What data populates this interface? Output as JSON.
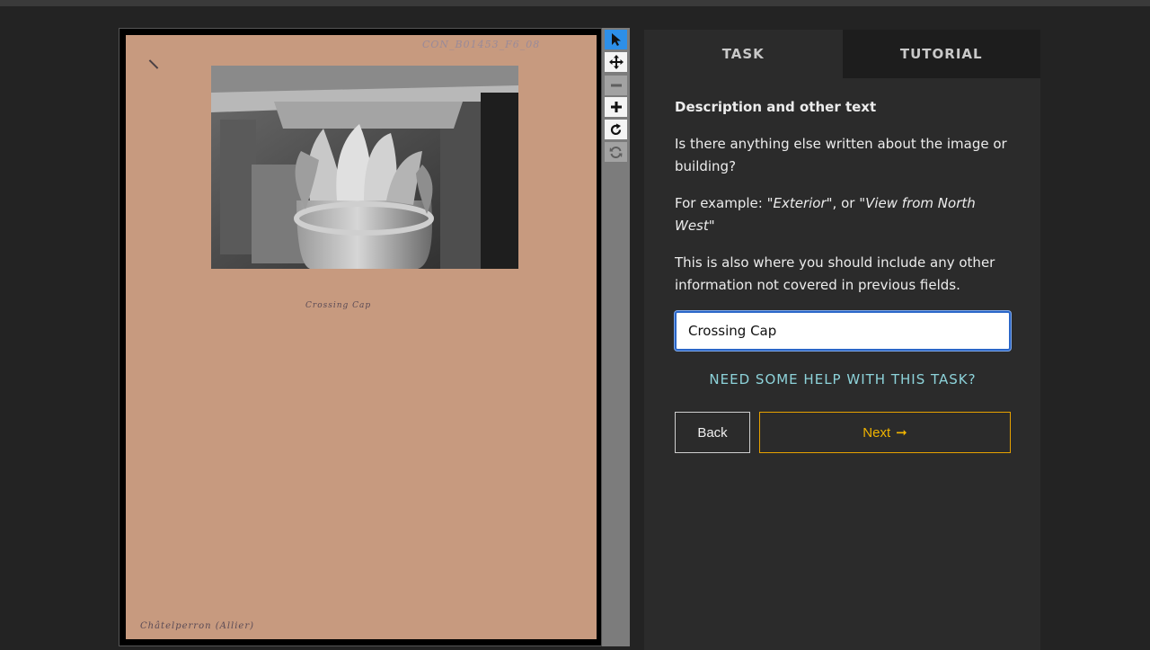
{
  "viewer": {
    "card": {
      "id_text": "CON_B01453_F6_08",
      "caption": "Crossing Cap",
      "location": "Châtelperron (Allier)"
    },
    "toolbar": {
      "tools": [
        {
          "name": "select",
          "icon": "pointer-icon",
          "state": "active"
        },
        {
          "name": "pan",
          "icon": "move-icon",
          "state": "enabled"
        },
        {
          "name": "zoom-out",
          "icon": "minus-icon",
          "state": "disabled"
        },
        {
          "name": "zoom-in",
          "icon": "plus-icon",
          "state": "enabled"
        },
        {
          "name": "rotate",
          "icon": "rotate-icon",
          "state": "enabled"
        },
        {
          "name": "reset",
          "icon": "reset-icon",
          "state": "disabled"
        }
      ]
    }
  },
  "panel": {
    "tabs": [
      {
        "label": "TASK",
        "active": true
      },
      {
        "label": "TUTORIAL",
        "active": false
      }
    ],
    "heading": "Description and other text",
    "question": "Is there anything else written about the image or building?",
    "example_prefix": "For example: ",
    "example_1": "\"Exterior\"",
    "example_sep": ", or ",
    "example_2": "\"View from North West\"",
    "info": "This is also where you should include any other information not covered in previous fields.",
    "input_value": "Crossing Cap",
    "help_link": "NEED SOME HELP WITH THIS TASK?",
    "back_label": "Back",
    "next_label": "Next",
    "next_arrow": "➞"
  },
  "colors": {
    "background": "#232323",
    "panel": "#2b2b2b",
    "card": "#c79a7f",
    "accent_blue": "#2d8fe8",
    "next_border": "#e6a100",
    "help_link": "#8dd3da"
  }
}
